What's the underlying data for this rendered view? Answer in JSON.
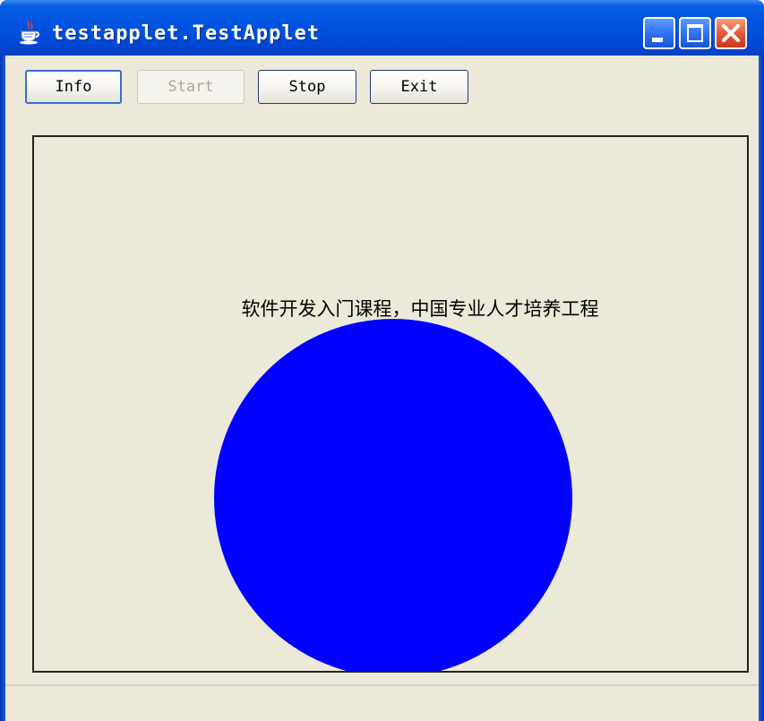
{
  "window": {
    "title": "testapplet.TestApplet",
    "app_icon": "java-coffee-cup-icon",
    "controls": {
      "minimize": "minimize-icon",
      "maximize": "maximize-icon",
      "close": "close-icon"
    },
    "colors": {
      "titlebar": "#0053e0",
      "client_background": "#ece9d8",
      "close_button": "#e0563a"
    }
  },
  "toolbar": {
    "info_label": "Info",
    "start_label": "Start",
    "start_enabled": false,
    "stop_label": "Stop",
    "exit_label": "Exit"
  },
  "applet": {
    "message": "软件开发入门课程，中国专业人才培养工程",
    "shape": "circle",
    "shape_color": "#0000ff"
  },
  "statusbar": {
    "text": ""
  }
}
